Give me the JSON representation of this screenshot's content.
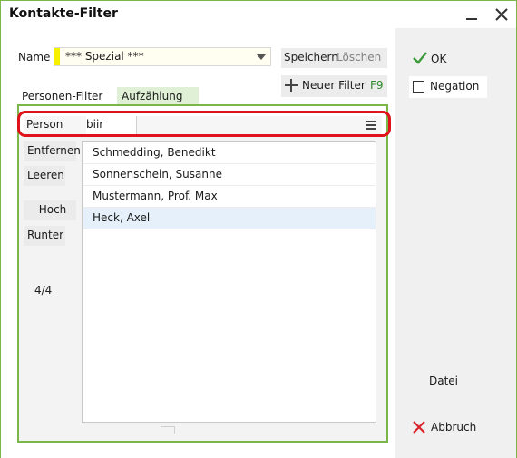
{
  "window": {
    "title": "Kontakte-Filter",
    "minimize_icon": "minimize-icon",
    "close_icon": "close-icon"
  },
  "name": {
    "label": "Name",
    "value": "*** Spezial ***",
    "dropdown_icon": "chevron-down-icon"
  },
  "toolbar": {
    "save_label": "Speichern",
    "delete_label": "Löschen",
    "new_filter_label": "Neuer Filter",
    "new_filter_shortcut": "F9",
    "new_filter_icon": "plus-icon"
  },
  "tabs": [
    {
      "label": "Personen-Filter",
      "active": false
    },
    {
      "label": "Aufzählung",
      "active": true
    }
  ],
  "person": {
    "label": "Person",
    "input_value": "biir",
    "menu_icon": "hamburger-menu-icon"
  },
  "side_buttons": {
    "remove": "Entfernen",
    "clear": "Leeren",
    "up": "Hoch",
    "down": "Runter"
  },
  "count": "4/4",
  "list": {
    "items": [
      {
        "name": "Schmedding, Benedikt",
        "selected": false
      },
      {
        "name": "Sonnenschein, Susanne",
        "selected": false
      },
      {
        "name": "Mustermann, Prof. Max",
        "selected": false
      },
      {
        "name": "Heck, Axel",
        "selected": true
      }
    ]
  },
  "actions": {
    "ok_label": "OK",
    "ok_icon": "checkmark-icon",
    "negation_label": "Negation",
    "negation_checked": false,
    "file_label": "Datei",
    "cancel_label": "Abbruch",
    "cancel_icon": "x-icon"
  },
  "colors": {
    "accent_green": "#7ab648",
    "highlight_red": "#e0121b",
    "name_marker_yellow": "#f6ef00",
    "selected_row": "#e6f0fa",
    "shortcut_green": "#2f8a2f",
    "cancel_red": "#d9232a"
  }
}
